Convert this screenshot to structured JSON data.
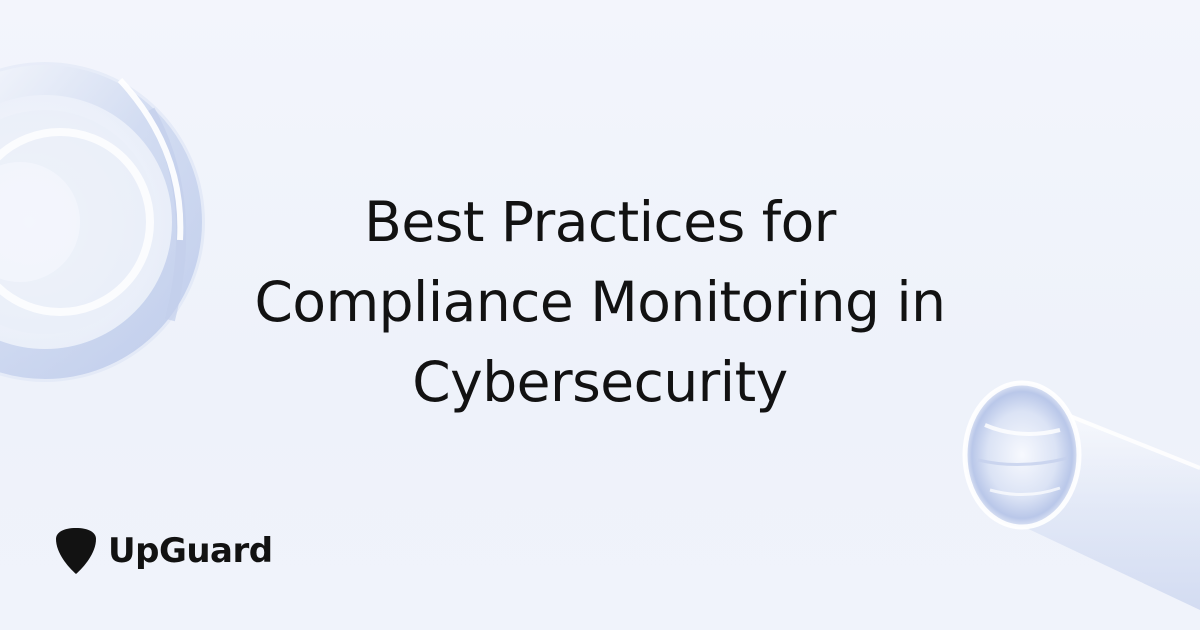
{
  "headline": {
    "line1": "Best Practices for",
    "line2": "Compliance Monitoring in",
    "line3": "Cybersecurity"
  },
  "brand": {
    "name": "UpGuard",
    "icon": "guitar-pick-shield-icon"
  },
  "colors": {
    "background": "#f0f3fb",
    "text": "#121212",
    "glass": "#d6dff2"
  }
}
